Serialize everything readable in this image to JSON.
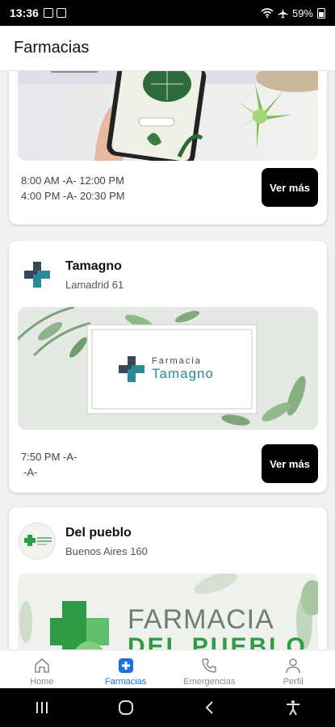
{
  "status_bar": {
    "time": "13:36",
    "battery": "59%"
  },
  "header": {
    "title": "Farmacias"
  },
  "cards": [
    {
      "name": "",
      "hours_line1": "8:00 AM -A- 12:00 PM",
      "hours_line2": "4:00 PM -A- 20:30 PM",
      "button_label": "Ver más"
    },
    {
      "name": "Tamagno",
      "address": "Lamadrid 61",
      "banner_word1": "Farmacia",
      "banner_word2": "Tamagno",
      "hours_line1": "7:50 PM -A-",
      "hours_line2": "-A-",
      "button_label": "Ver más"
    },
    {
      "name": "Del pueblo",
      "address": "Buenos Aires 160",
      "banner_word1": "FARMACIA",
      "banner_word2": "DEL PUEBLO"
    }
  ],
  "bottom_nav": [
    {
      "label": "Home",
      "icon": "home-icon"
    },
    {
      "label": "Farmacias",
      "icon": "pharmacy-plus-icon",
      "active": true
    },
    {
      "label": "Emergencias",
      "icon": "phone-icon"
    },
    {
      "label": "Perfil",
      "icon": "person-icon"
    }
  ],
  "colors": {
    "accent": "#1e6ee8",
    "teal": "#2a8a95",
    "green": "#2e9b45"
  }
}
